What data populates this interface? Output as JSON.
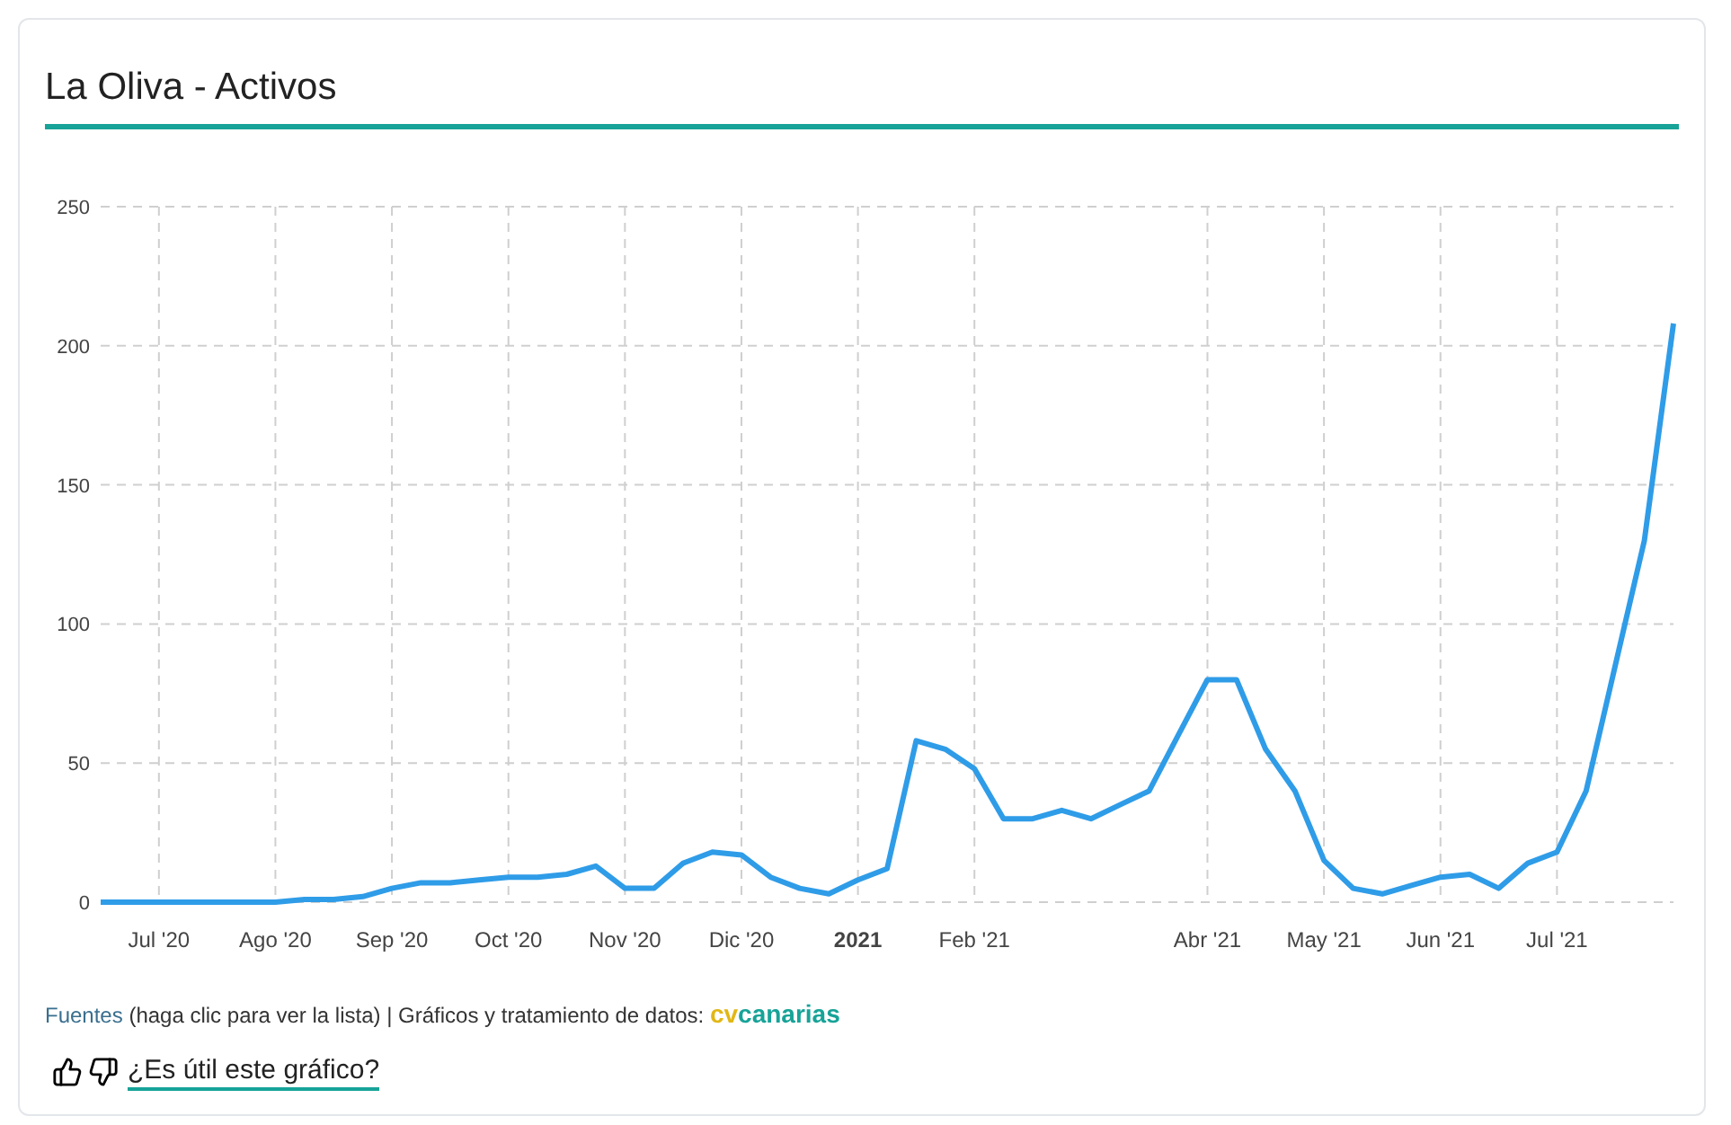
{
  "card": {
    "title": "La Oliva - Activos"
  },
  "chart_data": {
    "type": "line",
    "grid": true,
    "ylim": [
      0,
      250
    ],
    "categories": [
      null,
      null,
      "Jul '20",
      null,
      null,
      null,
      "Ago '20",
      null,
      null,
      null,
      "Sep '20",
      null,
      null,
      null,
      "Oct '20",
      null,
      null,
      null,
      "Nov '20",
      null,
      null,
      null,
      "Dic '20",
      null,
      null,
      null,
      "**2021**",
      null,
      null,
      null,
      "Feb '21",
      null,
      null,
      null,
      null,
      null,
      null,
      null,
      "Abr '21",
      null,
      null,
      null,
      "May '21",
      null,
      null,
      null,
      "Jun '21",
      null,
      null,
      null,
      "Jul '21",
      null,
      null,
      null,
      null
    ],
    "series": [
      {
        "color": "#2f9ce8",
        "values": [
          0,
          0,
          0,
          0,
          0,
          0,
          0,
          1,
          1,
          2,
          5,
          7,
          7,
          8,
          9,
          9,
          10,
          13,
          5,
          5,
          14,
          18,
          17,
          9,
          5,
          3,
          8,
          12,
          58,
          55,
          48,
          30,
          30,
          33,
          30,
          35,
          40,
          60,
          80,
          80,
          55,
          40,
          15,
          5,
          3,
          6,
          9,
          10,
          5,
          14,
          18,
          40,
          85,
          130,
          208
        ]
      }
    ],
    "yticks": [
      0,
      50,
      100,
      150,
      200,
      250
    ]
  },
  "footer": {
    "sources_link": "Fuentes",
    "sources_note": "(haga clic para ver la lista) | Gráficos y tratamiento de datos:",
    "brand_prefix": "cv",
    "brand_name": "canarias",
    "feedback_link": "¿Es útil este gráfico?"
  }
}
